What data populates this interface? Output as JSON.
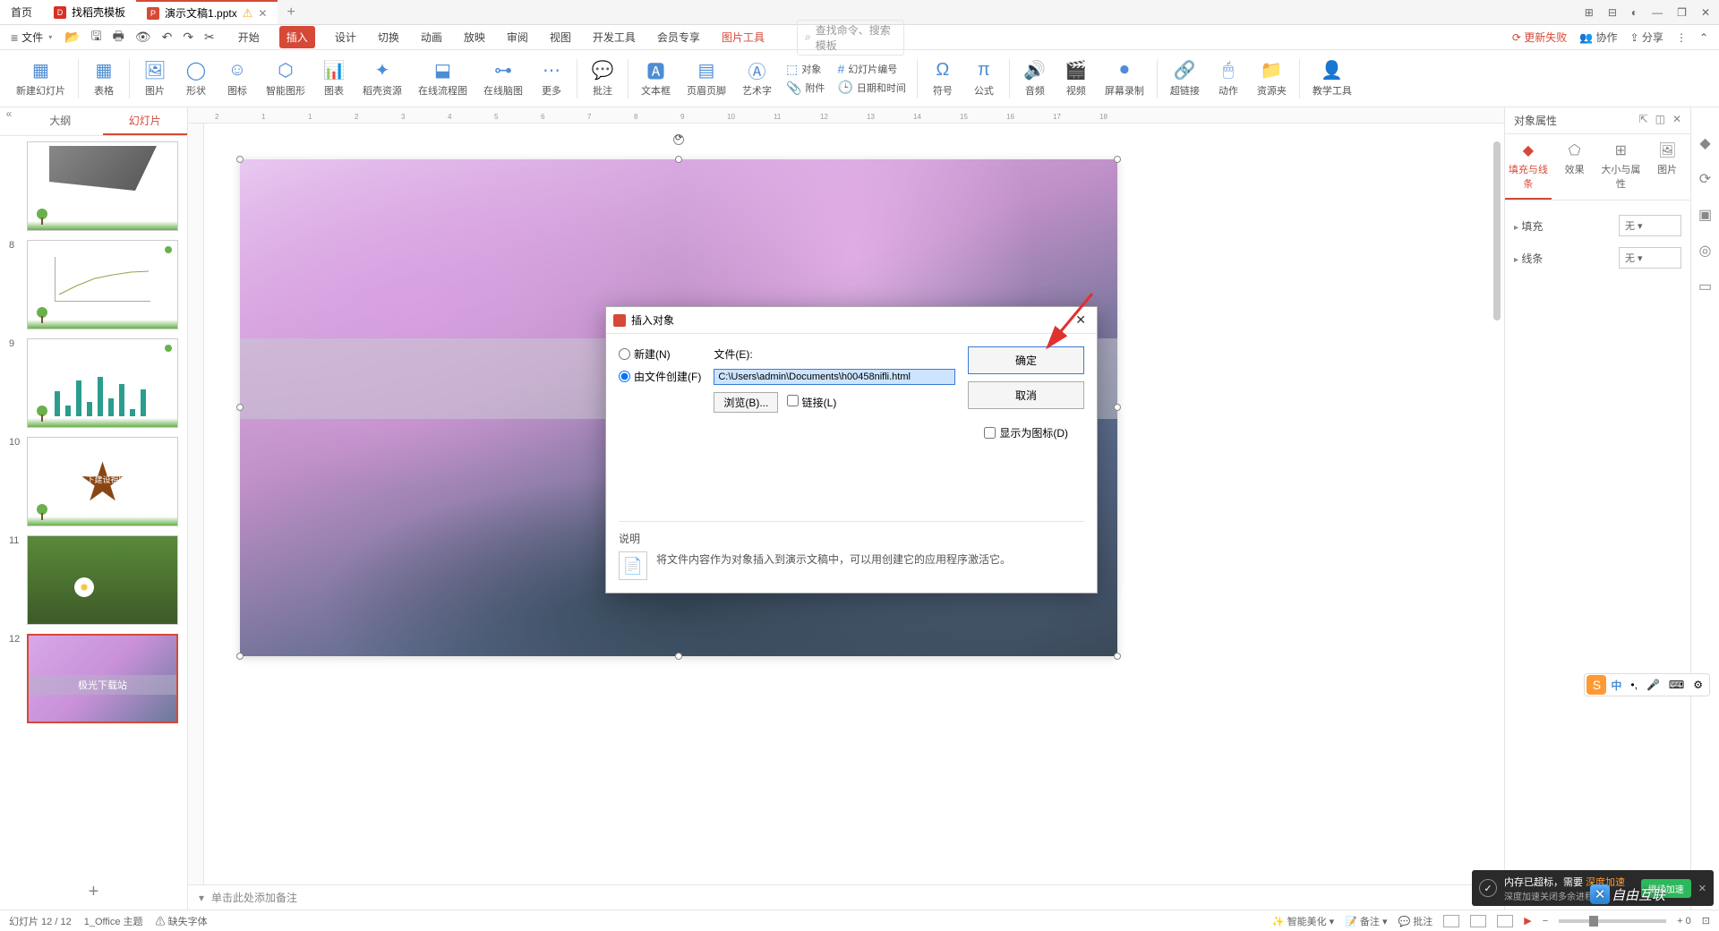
{
  "titlebar": {
    "home": "首页",
    "template": "找稻壳模板",
    "doc": "演示文稿1.pptx",
    "add": "+"
  },
  "winctrl": {
    "grid": "⊞",
    "apps": "⊟",
    "avatar": "◐",
    "min": "—",
    "max": "❐",
    "close": "✕"
  },
  "menubar": {
    "file": "文件",
    "qat": {
      "open": "📂",
      "save": "💾",
      "print": "🖨",
      "preview": "🔍",
      "undo": "↶",
      "redo": "↷",
      "format": "✂"
    },
    "tabs": {
      "start": "开始",
      "insert": "插入",
      "design": "设计",
      "transition": "切换",
      "animation": "动画",
      "slideshow": "放映",
      "review": "审阅",
      "view": "视图",
      "dev": "开发工具",
      "member": "会员专享",
      "pictool": "图片工具"
    },
    "search_placeholder": "查找命令、搜索模板",
    "right": {
      "update_fail": "更新失败",
      "coop": "协作",
      "share": "分享"
    }
  },
  "ribbon": {
    "newslide": "新建幻灯片",
    "table": "表格",
    "picture": "图片",
    "shape": "形状",
    "icon": "图标",
    "smartart": "智能图形",
    "chart": "图表",
    "resource": "稻壳资源",
    "flowchart": "在线流程图",
    "mindmap": "在线脑图",
    "more": "更多",
    "comment": "批注",
    "textbox": "文本框",
    "headerfooter": "页眉页脚",
    "wordart": "艺术字",
    "object": "对象",
    "attachment": "附件",
    "slidenum": "幻灯片编号",
    "datetime": "日期和时间",
    "symbol": "符号",
    "formula": "公式",
    "audio": "音频",
    "video": "视频",
    "screenrec": "屏幕录制",
    "hyperlink": "超链接",
    "action": "动作",
    "resourcelib": "资源夹",
    "teaching": "教学工具"
  },
  "thumbpanel": {
    "tab_outline": "大纲",
    "tab_slides": "幻灯片",
    "add": "+",
    "nums": [
      "8",
      "9",
      "10",
      "11",
      "12"
    ],
    "slide10_text": "…下建设祖国",
    "slide12_text": "极光下载站"
  },
  "rightpanel": {
    "title": "对象属性",
    "tabs": {
      "fill": "填充与线条",
      "effect": "效果",
      "size": "大小与属性",
      "pic": "图片"
    },
    "fill_label": "填充",
    "fill_value": "无",
    "line_label": "线条",
    "line_value": "无"
  },
  "dialog": {
    "title": "插入对象",
    "opt_new": "新建(N)",
    "opt_file": "由文件创建(F)",
    "file_label": "文件(E):",
    "file_value": "C:\\Users\\admin\\Documents\\h00458nifli.html",
    "browse": "浏览(B)...",
    "link": "链接(L)",
    "showicon": "显示为图标(D)",
    "ok": "确定",
    "cancel": "取消",
    "desc_title": "说明",
    "desc_text": "将文件内容作为对象插入到演示文稿中，可以用创建它的应用程序激活它。"
  },
  "notes": {
    "placeholder": "单击此处添加备注"
  },
  "statusbar": {
    "slide_info": "幻灯片 12 / 12",
    "theme": "1_Office 主题",
    "missing_font": "缺失字体",
    "beautify": "智能美化",
    "notes_btn": "备注",
    "comment_btn": "批注",
    "zoom": "+ 0"
  },
  "notify": {
    "text1": "内存已超标，需要",
    "text2": "深度加速",
    "sub": "深度加速关闭多余进程",
    "btn": "继续加速"
  },
  "watermark": "自由互联",
  "ime": {
    "zh": "中"
  },
  "ruler_marks": [
    "2",
    "1",
    "1",
    "2",
    "3",
    "4",
    "5",
    "6",
    "7",
    "8",
    "9",
    "10",
    "11",
    "12",
    "13",
    "14",
    "15",
    "16",
    "17",
    "18"
  ]
}
